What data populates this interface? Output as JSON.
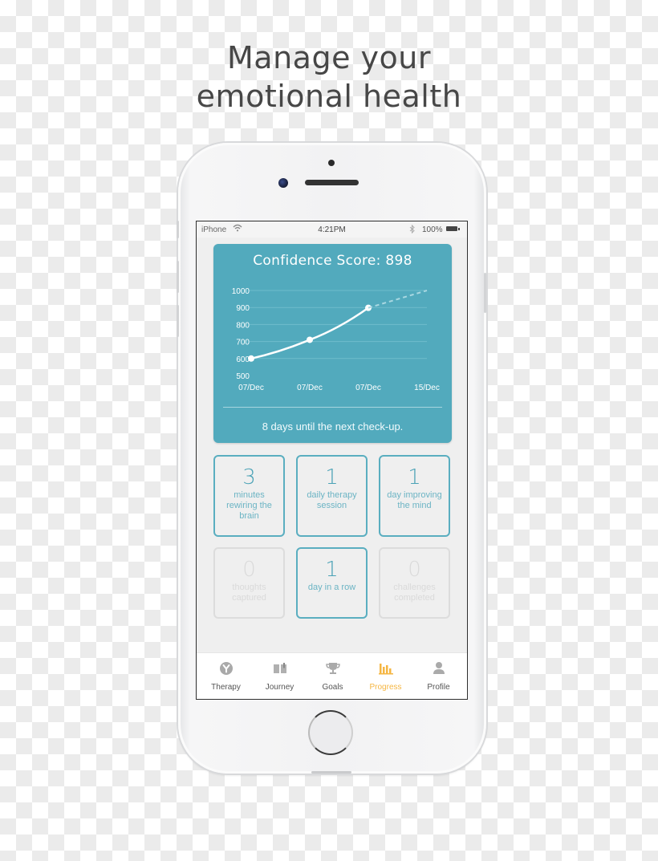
{
  "headline": {
    "line1": "Manage your",
    "line2": "emotional health"
  },
  "status_bar": {
    "carrier": "iPhone",
    "wifi_icon": "wifi-icon",
    "time": "4:21PM",
    "bluetooth_icon": "bluetooth-icon",
    "battery_percent": "100%",
    "battery_icon": "battery-icon"
  },
  "score_card": {
    "title": "Confidence Score: 898",
    "checkup_text": "8 days until the next check-up.",
    "background_color": "#52aabd"
  },
  "chart_data": {
    "type": "line",
    "title": "Confidence Score: 898",
    "categories": [
      "07/Dec",
      "07/Dec",
      "07/Dec",
      "15/Dec"
    ],
    "series": [
      {
        "name": "score",
        "style": "solid",
        "values": [
          600,
          710,
          898,
          null
        ]
      },
      {
        "name": "projection",
        "style": "dashed",
        "values": [
          null,
          null,
          898,
          1000
        ]
      }
    ],
    "yticks": [
      1000,
      900,
      800,
      700,
      600,
      500
    ],
    "ylim": [
      500,
      1000
    ],
    "xlabel": "",
    "ylabel": "",
    "grid": true
  },
  "stats": [
    {
      "value": "3",
      "label": "minutes rewiring the brain",
      "active": true
    },
    {
      "value": "1",
      "label": "daily therapy session",
      "active": true
    },
    {
      "value": "1",
      "label": "day improving the mind",
      "active": true
    },
    {
      "value": "0",
      "label": "thoughts captured",
      "active": false
    },
    {
      "value": "1",
      "label": "day in a row",
      "active": true
    },
    {
      "value": "0",
      "label": "challenges completed",
      "active": false
    }
  ],
  "tabs": [
    {
      "label": "Therapy",
      "icon": "therapy-icon",
      "active": false
    },
    {
      "label": "Journey",
      "icon": "journey-book-icon",
      "active": false
    },
    {
      "label": "Goals",
      "icon": "trophy-icon",
      "active": false
    },
    {
      "label": "Progress",
      "icon": "bar-chart-icon",
      "active": true
    },
    {
      "label": "Profile",
      "icon": "person-icon",
      "active": false
    }
  ],
  "colors": {
    "accent": "#52aabd",
    "active_tab": "#f5b642",
    "inactive_tab": "#aaaaaa"
  }
}
